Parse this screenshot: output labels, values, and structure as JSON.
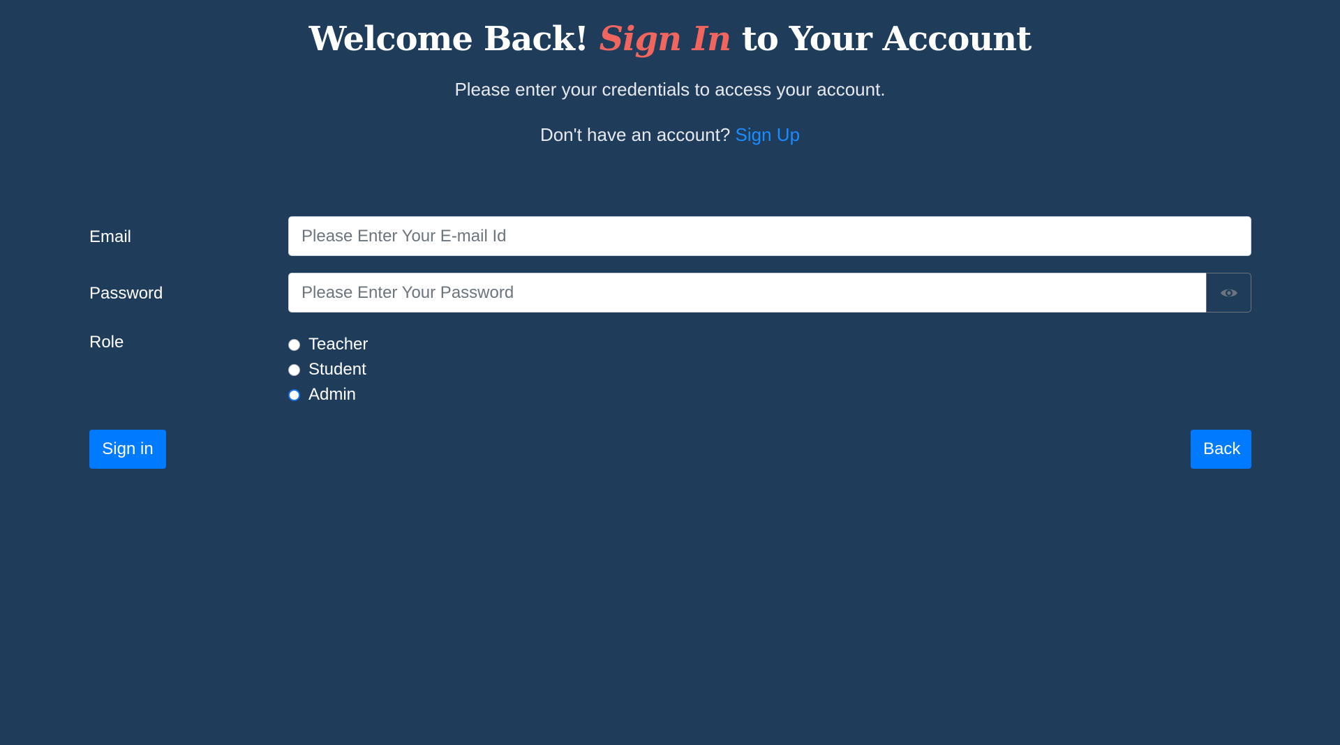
{
  "header": {
    "title_part1": "Welcome Back! ",
    "title_accent": "Sign In",
    "title_part2": " to Your Account",
    "subtitle": "Please enter your credentials to access your account.",
    "signup_prompt": "Don't have an account? ",
    "signup_link": "Sign Up"
  },
  "form": {
    "email_label": "Email",
    "email_placeholder": "Please Enter Your E-mail Id",
    "email_value": "",
    "password_label": "Password",
    "password_placeholder": "Please Enter Your Password",
    "password_value": "",
    "password_toggle_icon": "eye-icon",
    "role_label": "Role",
    "roles": [
      {
        "label": "Teacher",
        "checked": false
      },
      {
        "label": "Student",
        "checked": false
      },
      {
        "label": "Admin",
        "checked": true
      }
    ],
    "signin_label": "Sign in",
    "back_label": "Back"
  },
  "colors": {
    "background": "#1f3d5b",
    "accent_title": "#f0665f",
    "link": "#1a8cff",
    "button": "#007bff"
  }
}
